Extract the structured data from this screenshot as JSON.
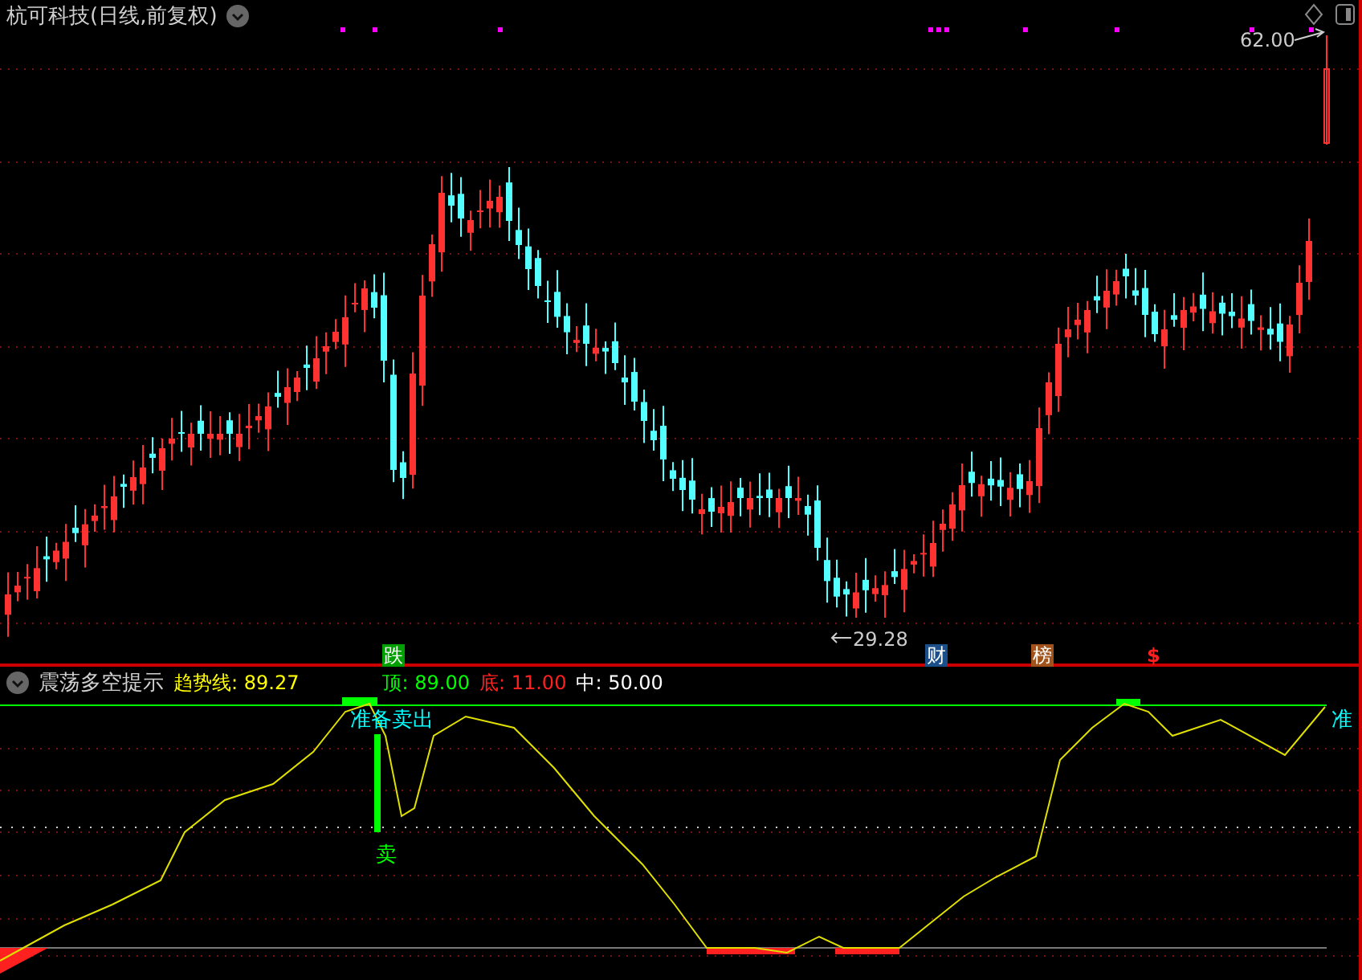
{
  "title": "杭可科技(日线,前复权)",
  "price_labels": {
    "high": "62.00",
    "low": "29.28"
  },
  "markers": [
    {
      "label": "跌",
      "kind": "badge",
      "color": "#00a000"
    },
    {
      "label": "财",
      "kind": "badge",
      "color": "#1a4f8a"
    },
    {
      "label": "榜",
      "kind": "badge",
      "color": "#a0521a"
    },
    {
      "label": "$",
      "kind": "text",
      "color": "#ff2020"
    }
  ],
  "indicator": {
    "name": "震荡多空提示",
    "trend": {
      "label": "趋势线:",
      "value": "89.27"
    },
    "levels": [
      {
        "label": "顶:",
        "value": "89.00",
        "color": "#00ff00"
      },
      {
        "label": "底:",
        "value": "11.00",
        "color": "#ff2020"
      },
      {
        "label": "中:",
        "value": "50.00",
        "color": "#ffffff"
      }
    ],
    "signals": [
      {
        "text": "准备卖出",
        "kind": "warn"
      },
      {
        "text": "卖",
        "kind": "sell"
      },
      {
        "text": "准",
        "kind": "warn"
      }
    ]
  }
}
